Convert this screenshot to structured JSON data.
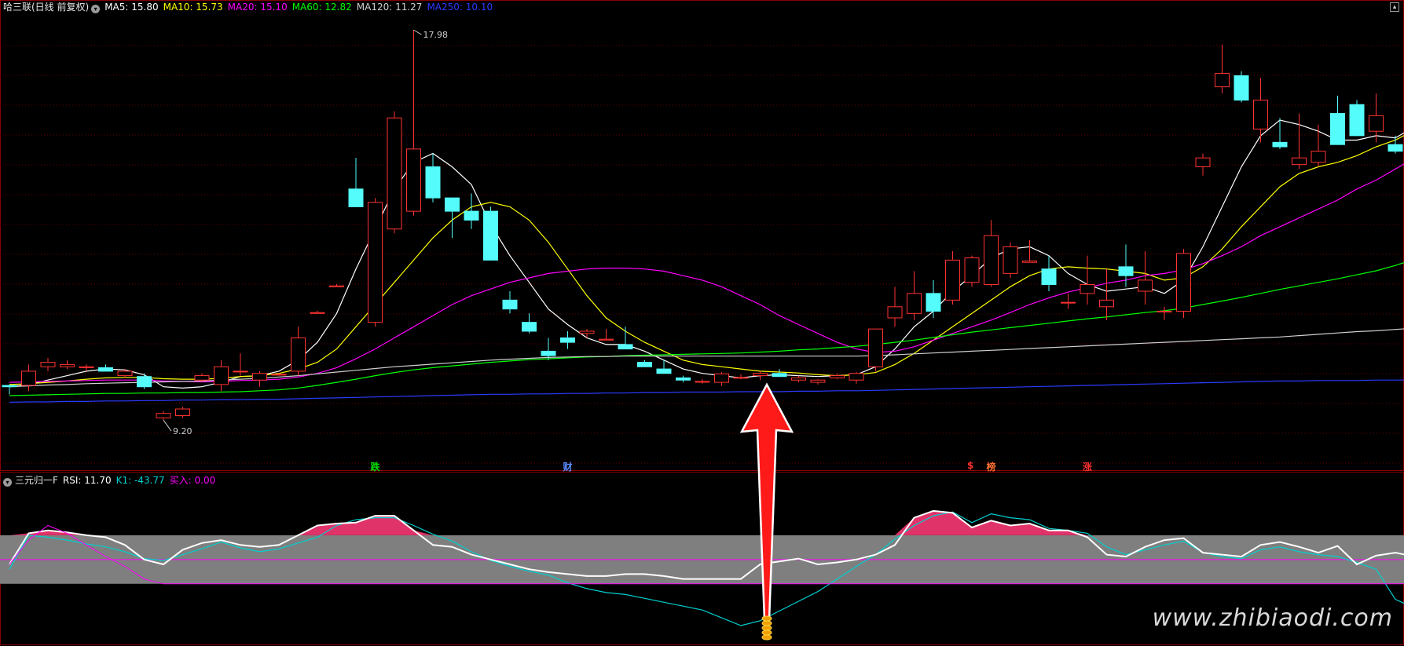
{
  "header": {
    "title": "哈三联(日线 前复权)",
    "ma_labels": [
      {
        "text": "MA5: 15.80",
        "color": "#ffffff"
      },
      {
        "text": "MA10: 15.73",
        "color": "#ffff00"
      },
      {
        "text": "MA20: 15.10",
        "color": "#ff00ff"
      },
      {
        "text": "MA60: 12.82",
        "color": "#00ff00"
      },
      {
        "text": "MA120: 11.27",
        "color": "#d0d0d0"
      },
      {
        "text": "MA250: 10.10",
        "color": "#2b3bff"
      }
    ]
  },
  "indicator_header": {
    "name": "三元归一F",
    "labels": [
      {
        "text": "RSI: 11.70",
        "color": "#ffffff"
      },
      {
        "text": "K1: -43.77",
        "color": "#00d0d0"
      },
      {
        "text": "买入: 0.00",
        "color": "#ff00ff"
      }
    ]
  },
  "event_markers": [
    {
      "text": "跌",
      "color": "#00e000",
      "x_index": 19
    },
    {
      "text": "财",
      "color": "#5a8cff",
      "x_index": 29
    },
    {
      "text": "$",
      "color": "#ff3030",
      "x_index": 50
    },
    {
      "text": "榜",
      "color": "#ff7030",
      "x_index": 51
    },
    {
      "text": "涨",
      "color": "#ff3030",
      "x_index": 56
    }
  ],
  "watermark": "www.zhibiaodi.com",
  "chart_data": [
    {
      "type": "candlestick",
      "high_label": "17.98",
      "low_label": "9.20",
      "candles": [
        [
          9.98,
          10.0,
          9.78,
          9.95
        ],
        [
          9.98,
          10.45,
          9.85,
          10.3
        ],
        [
          10.4,
          10.6,
          10.3,
          10.5
        ],
        [
          10.4,
          10.55,
          10.35,
          10.45
        ],
        [
          10.38,
          10.45,
          10.3,
          10.4
        ],
        [
          10.38,
          10.45,
          10.3,
          10.3
        ],
        [
          10.2,
          10.35,
          10.15,
          10.3
        ],
        [
          10.18,
          10.25,
          9.9,
          9.95
        ],
        [
          9.25,
          9.4,
          9.2,
          9.35
        ],
        [
          9.3,
          9.5,
          9.25,
          9.45
        ],
        [
          10.1,
          10.25,
          10.05,
          10.2
        ],
        [
          10.0,
          10.55,
          9.85,
          10.4
        ],
        [
          10.3,
          10.7,
          10.2,
          10.3
        ],
        [
          10.1,
          10.3,
          9.95,
          10.25
        ],
        [
          10.23,
          10.26,
          10.2,
          10.23
        ],
        [
          10.3,
          11.3,
          10.2,
          11.05
        ],
        [
          11.6,
          11.66,
          11.6,
          11.62
        ],
        [
          12.2,
          12.26,
          12.2,
          12.22
        ],
        [
          14.4,
          15.1,
          14.0,
          14.0
        ],
        [
          11.4,
          14.2,
          11.3,
          14.1
        ],
        [
          13.5,
          16.15,
          13.4,
          16.0
        ],
        [
          13.9,
          17.98,
          13.8,
          15.3
        ],
        [
          14.9,
          15.2,
          14.1,
          14.2
        ],
        [
          14.2,
          14.2,
          13.3,
          13.9
        ],
        [
          13.9,
          14.3,
          13.5,
          13.7
        ],
        [
          13.9,
          14.0,
          12.8,
          12.8
        ],
        [
          11.9,
          12.1,
          11.6,
          11.7
        ],
        [
          11.4,
          11.6,
          11.15,
          11.2
        ],
        [
          10.75,
          11.05,
          10.55,
          10.65
        ],
        [
          11.05,
          11.2,
          10.8,
          10.95
        ],
        [
          11.15,
          11.25,
          11.05,
          11.2
        ],
        [
          11.0,
          11.25,
          11.02,
          11.02
        ],
        [
          10.9,
          11.3,
          10.9,
          10.8
        ],
        [
          10.5,
          10.55,
          10.4,
          10.4
        ],
        [
          10.35,
          10.55,
          10.25,
          10.25
        ],
        [
          10.15,
          10.2,
          10.05,
          10.1
        ],
        [
          10.07,
          10.12,
          10.02,
          10.07
        ],
        [
          10.05,
          10.28,
          9.97,
          10.24
        ],
        [
          10.15,
          10.23,
          10.12,
          10.16
        ],
        [
          10.2,
          10.3,
          10.1,
          10.25
        ],
        [
          10.25,
          10.35,
          10.18,
          10.18
        ],
        [
          10.1,
          10.2,
          10.05,
          10.15
        ],
        [
          10.05,
          10.12,
          10.0,
          10.1
        ],
        [
          10.15,
          10.25,
          10.12,
          10.2
        ],
        [
          10.1,
          10.28,
          10.02,
          10.25
        ],
        [
          10.4,
          11.25,
          10.3,
          11.25
        ],
        [
          11.5,
          12.2,
          11.3,
          11.75
        ],
        [
          11.6,
          12.55,
          11.45,
          12.05
        ],
        [
          12.05,
          12.35,
          11.5,
          11.65
        ],
        [
          11.9,
          13.0,
          11.8,
          12.8
        ],
        [
          12.3,
          12.9,
          12.2,
          12.85
        ],
        [
          12.25,
          13.7,
          12.2,
          13.35
        ],
        [
          12.5,
          13.2,
          12.4,
          13.1
        ],
        [
          12.75,
          13.25,
          12.9,
          12.78
        ],
        [
          12.6,
          12.9,
          12.1,
          12.25
        ],
        [
          11.85,
          12.05,
          11.7,
          11.85
        ],
        [
          12.05,
          12.9,
          11.8,
          12.25
        ],
        [
          11.75,
          12.6,
          11.45,
          11.9
        ],
        [
          12.65,
          13.15,
          12.2,
          12.45
        ],
        [
          12.1,
          13.0,
          11.8,
          12.35
        ],
        [
          11.65,
          11.75,
          11.45,
          11.65
        ],
        [
          11.65,
          13.05,
          11.5,
          12.95
        ],
        [
          14.9,
          15.2,
          14.7,
          15.1
        ],
        [
          16.7,
          17.65,
          16.55,
          17.0
        ],
        [
          16.95,
          17.05,
          16.35,
          16.4
        ],
        [
          15.75,
          16.9,
          15.45,
          16.4
        ],
        [
          15.45,
          16.0,
          15.3,
          15.35
        ],
        [
          14.95,
          16.1,
          14.85,
          15.1
        ],
        [
          15.0,
          15.85,
          14.9,
          15.25
        ],
        [
          16.1,
          16.5,
          15.5,
          15.4
        ],
        [
          16.3,
          16.4,
          15.6,
          15.6
        ],
        [
          15.7,
          16.55,
          15.45,
          16.05
        ],
        [
          15.4,
          15.6,
          15.2,
          15.25
        ],
        [
          16.1,
          16.2,
          14.65,
          15.05
        ]
      ],
      "moving_averages": [
        {
          "name": "MA5",
          "color": "#ffffff",
          "values": [
            9.95,
            10.0,
            10.1,
            10.2,
            10.3,
            10.35,
            10.33,
            10.22,
            9.95,
            9.92,
            9.95,
            10.05,
            10.18,
            10.2,
            10.3,
            10.55,
            10.95,
            11.6,
            12.6,
            13.5,
            14.4,
            15.0,
            15.2,
            14.9,
            14.5,
            13.6,
            12.9,
            12.3,
            11.7,
            11.35,
            11.05,
            10.9,
            10.9,
            10.75,
            10.55,
            10.35,
            10.25,
            10.2,
            10.15,
            10.2,
            10.22,
            10.2,
            10.18,
            10.2,
            10.22,
            10.4,
            10.8,
            11.3,
            11.65,
            12.1,
            12.45,
            12.85,
            13.05,
            13.1,
            12.9,
            12.5,
            12.25,
            12.1,
            12.15,
            12.2,
            12.05,
            12.35,
            13.1,
            14.0,
            14.9,
            15.6,
            15.95,
            15.85,
            15.7,
            15.5,
            15.5,
            15.6,
            15.55,
            15.8
          ]
        },
        {
          "name": "MA10",
          "color": "#ffff00",
          "values": [
            10.0,
            10.02,
            10.05,
            10.08,
            10.12,
            10.15,
            10.16,
            10.16,
            10.13,
            10.12,
            10.12,
            10.14,
            10.18,
            10.2,
            10.25,
            10.35,
            10.5,
            10.8,
            11.3,
            11.8,
            12.3,
            12.8,
            13.3,
            13.7,
            14.0,
            14.1,
            14.0,
            13.7,
            13.2,
            12.6,
            12.0,
            11.5,
            11.2,
            10.95,
            10.75,
            10.55,
            10.45,
            10.4,
            10.35,
            10.3,
            10.28,
            10.26,
            10.22,
            10.2,
            10.22,
            10.27,
            10.45,
            10.7,
            11.0,
            11.3,
            11.6,
            11.9,
            12.2,
            12.45,
            12.6,
            12.65,
            12.62,
            12.6,
            12.55,
            12.5,
            12.35,
            12.4,
            12.65,
            13.05,
            13.55,
            14.0,
            14.45,
            14.75,
            14.9,
            15.0,
            15.15,
            15.35,
            15.5,
            15.73
          ]
        },
        {
          "name": "MA20",
          "color": "#ff00ff",
          "values": [
            10.05,
            10.06,
            10.07,
            10.08,
            10.09,
            10.1,
            10.1,
            10.1,
            10.08,
            10.07,
            10.06,
            10.07,
            10.09,
            10.1,
            10.12,
            10.17,
            10.25,
            10.38,
            10.58,
            10.8,
            11.05,
            11.3,
            11.55,
            11.8,
            12.0,
            12.15,
            12.3,
            12.4,
            12.5,
            12.55,
            12.6,
            12.62,
            12.62,
            12.6,
            12.55,
            12.45,
            12.35,
            12.2,
            12.0,
            11.8,
            11.55,
            11.35,
            11.15,
            10.95,
            10.8,
            10.72,
            10.75,
            10.85,
            11.0,
            11.15,
            11.3,
            11.45,
            11.62,
            11.8,
            11.95,
            12.08,
            12.18,
            12.28,
            12.35,
            12.45,
            12.5,
            12.58,
            12.72,
            12.9,
            13.1,
            13.35,
            13.55,
            13.75,
            13.95,
            14.15,
            14.4,
            14.6,
            14.85,
            15.1
          ]
        },
        {
          "name": "MA60",
          "color": "#00ff00",
          "values": [
            9.75,
            9.76,
            9.77,
            9.78,
            9.79,
            9.8,
            9.8,
            9.81,
            9.81,
            9.82,
            9.82,
            9.83,
            9.84,
            9.86,
            9.88,
            9.92,
            9.98,
            10.05,
            10.12,
            10.2,
            10.27,
            10.33,
            10.38,
            10.42,
            10.46,
            10.5,
            10.53,
            10.56,
            10.58,
            10.6,
            10.62,
            10.63,
            10.65,
            10.66,
            10.67,
            10.68,
            10.69,
            10.7,
            10.71,
            10.73,
            10.75,
            10.78,
            10.8,
            10.83,
            10.86,
            10.9,
            10.95,
            11.0,
            11.06,
            11.12,
            11.18,
            11.23,
            11.28,
            11.33,
            11.38,
            11.43,
            11.48,
            11.52,
            11.57,
            11.62,
            11.66,
            11.72,
            11.8,
            11.88,
            11.96,
            12.05,
            12.14,
            12.22,
            12.3,
            12.38,
            12.47,
            12.56,
            12.68,
            12.82
          ]
        },
        {
          "name": "MA120",
          "color": "#d0d0d0",
          "values": [
            9.95,
            9.97,
            9.99,
            10.0,
            10.02,
            10.03,
            10.04,
            10.05,
            10.06,
            10.07,
            10.08,
            10.1,
            10.12,
            10.14,
            10.17,
            10.2,
            10.24,
            10.28,
            10.32,
            10.36,
            10.4,
            10.43,
            10.46,
            10.49,
            10.52,
            10.55,
            10.57,
            10.59,
            10.61,
            10.62,
            10.63,
            10.63,
            10.64,
            10.64,
            10.64,
            10.64,
            10.64,
            10.64,
            10.64,
            10.64,
            10.64,
            10.64,
            10.64,
            10.64,
            10.64,
            10.65,
            10.67,
            10.69,
            10.71,
            10.73,
            10.75,
            10.77,
            10.79,
            10.81,
            10.83,
            10.85,
            10.87,
            10.89,
            10.91,
            10.93,
            10.95,
            10.97,
            10.99,
            11.01,
            11.03,
            11.05,
            11.07,
            11.1,
            11.13,
            11.16,
            11.19,
            11.21,
            11.24,
            11.27
          ]
        },
        {
          "name": "MA250",
          "color": "#2b3bff",
          "values": [
            9.6,
            9.61,
            9.61,
            9.62,
            9.62,
            9.63,
            9.63,
            9.64,
            9.64,
            9.65,
            9.65,
            9.66,
            9.66,
            9.67,
            9.67,
            9.68,
            9.69,
            9.7,
            9.71,
            9.72,
            9.73,
            9.74,
            9.75,
            9.76,
            9.77,
            9.78,
            9.78,
            9.79,
            9.79,
            9.8,
            9.8,
            9.81,
            9.81,
            9.82,
            9.82,
            9.83,
            9.83,
            9.83,
            9.84,
            9.84,
            9.84,
            9.85,
            9.85,
            9.86,
            9.86,
            9.87,
            9.88,
            9.89,
            9.9,
            9.91,
            9.92,
            9.93,
            9.94,
            9.95,
            9.96,
            9.97,
            9.98,
            9.99,
            10.0,
            10.01,
            10.02,
            10.03,
            10.04,
            10.05,
            10.06,
            10.07,
            10.08,
            10.08,
            10.09,
            10.09,
            10.09,
            10.1,
            10.1,
            10.1
          ]
        }
      ]
    },
    {
      "type": "line",
      "name": "三元归一F",
      "ylim": [
        -60,
        100
      ],
      "band": [
        0,
        50
      ],
      "midline": 25,
      "rsi": [
        20,
        52,
        55,
        53,
        50,
        48,
        40,
        25,
        20,
        35,
        42,
        45,
        40,
        38,
        40,
        50,
        60,
        62,
        63,
        70,
        70,
        55,
        40,
        38,
        30,
        25,
        20,
        15,
        12,
        10,
        8,
        8,
        10,
        10,
        8,
        5,
        5,
        5,
        5,
        20,
        23,
        26,
        20,
        22,
        25,
        30,
        40,
        68,
        75,
        73,
        58,
        65,
        60,
        62,
        55,
        55,
        48,
        30,
        28,
        38,
        45,
        47,
        32,
        30,
        28,
        40,
        43,
        38,
        32,
        39,
        20,
        29,
        32,
        28
      ],
      "k1": [
        15,
        50,
        48,
        45,
        41,
        38,
        33,
        26,
        24,
        30,
        36,
        43,
        37,
        33,
        36,
        42,
        48,
        60,
        66,
        68,
        68,
        60,
        51,
        44,
        33,
        24,
        18,
        13,
        9,
        1,
        -5,
        -9,
        -11,
        -15,
        -19,
        -23,
        -27,
        -35,
        -43,
        -38,
        -28,
        -18,
        -8,
        5,
        18,
        30,
        46,
        60,
        70,
        74,
        63,
        72,
        68,
        66,
        57,
        55,
        52,
        38,
        30,
        35,
        40,
        44,
        32,
        28,
        26,
        35,
        38,
        33,
        30,
        28,
        22,
        15,
        -16,
        -25
      ],
      "buy": [
        20,
        45,
        60,
        52,
        40,
        28,
        18,
        5,
        0,
        0,
        0,
        0,
        0,
        0,
        0,
        0,
        0,
        0,
        0,
        0,
        0,
        0,
        0,
        0,
        0,
        0,
        0,
        0,
        0,
        0,
        0,
        0,
        0,
        0,
        0,
        0,
        0,
        0,
        0,
        0,
        0,
        0,
        0,
        0,
        0,
        0,
        0,
        0,
        0,
        0,
        0,
        0,
        0,
        0,
        0,
        0,
        0,
        0,
        0,
        0,
        0,
        0,
        0,
        0,
        0,
        0,
        0,
        0,
        0,
        0,
        0,
        0,
        0,
        0
      ]
    }
  ]
}
